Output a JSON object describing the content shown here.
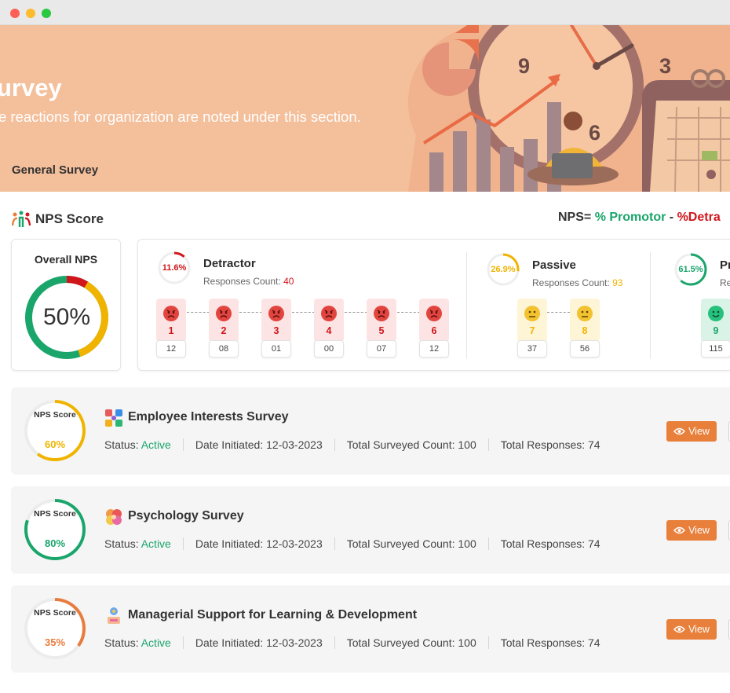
{
  "banner": {
    "title": "urvey",
    "subtitle": "e reactions for organization are noted under this section.",
    "tab": "General Survey",
    "clock_numbers": [
      "9",
      "3",
      "6"
    ]
  },
  "nps_section": {
    "title": "NPS Score",
    "formula": {
      "prefix": "NPS= ",
      "promotor": "% Promotor",
      "minus": " - ",
      "detractor": "%Detra"
    }
  },
  "overall": {
    "label": "Overall NPS",
    "value": "50%",
    "value_percent": 50
  },
  "categories": [
    {
      "name": "Detractor",
      "percent": "11.6%",
      "percent_value": 11.6,
      "count_label": "Responses Count:",
      "count": "40",
      "color": "#d0161b",
      "scores": [
        {
          "score": "1",
          "count": "12"
        },
        {
          "score": "2",
          "count": "08"
        },
        {
          "score": "3",
          "count": "01"
        },
        {
          "score": "4",
          "count": "00"
        },
        {
          "score": "5",
          "count": "07"
        },
        {
          "score": "6",
          "count": "12"
        }
      ]
    },
    {
      "name": "Passive",
      "percent": "26.9%",
      "percent_value": 26.9,
      "count_label": "Responses Count:",
      "count": "93",
      "color": "#f0b400",
      "scores": [
        {
          "score": "7",
          "count": "37"
        },
        {
          "score": "8",
          "count": "56"
        }
      ]
    },
    {
      "name": "Pro",
      "percent": "61.5%",
      "percent_value": 61.5,
      "count_label": "Res",
      "count": "",
      "color": "#1aa56b",
      "scores": [
        {
          "score": "9",
          "count": "115"
        }
      ]
    }
  ],
  "surveys": [
    {
      "nps_label": "NPS Score",
      "score": "60%",
      "score_value": 60,
      "color": "#f0b400",
      "title": "Employee Interests Survey",
      "status_label": "Status:",
      "status": "Active",
      "date": "Date Initiated: 12-03-2023",
      "surveyed": "Total Surveyed Count: 100",
      "responses": "Total Responses: 74",
      "view": "View",
      "icon": "interests-icon"
    },
    {
      "nps_label": "NPS Score",
      "score": "80%",
      "score_value": 80,
      "color": "#1aa56b",
      "title": "Psychology Survey",
      "status_label": "Status:",
      "status": "Active",
      "date": "Date Initiated: 12-03-2023",
      "surveyed": "Total Surveyed Count: 100",
      "responses": "Total Responses: 74",
      "view": "View",
      "icon": "brain-icon"
    },
    {
      "nps_label": "NPS Score",
      "score": "35%",
      "score_value": 35,
      "color": "#e87c3e",
      "title": "Managerial Support for Learning & Development",
      "status_label": "Status:",
      "status": "Active",
      "date": "Date Initiated: 12-03-2023",
      "surveyed": "Total Surveyed Count: 100",
      "responses": "Total Responses: 74",
      "view": "View",
      "icon": "learning-icon"
    }
  ]
}
